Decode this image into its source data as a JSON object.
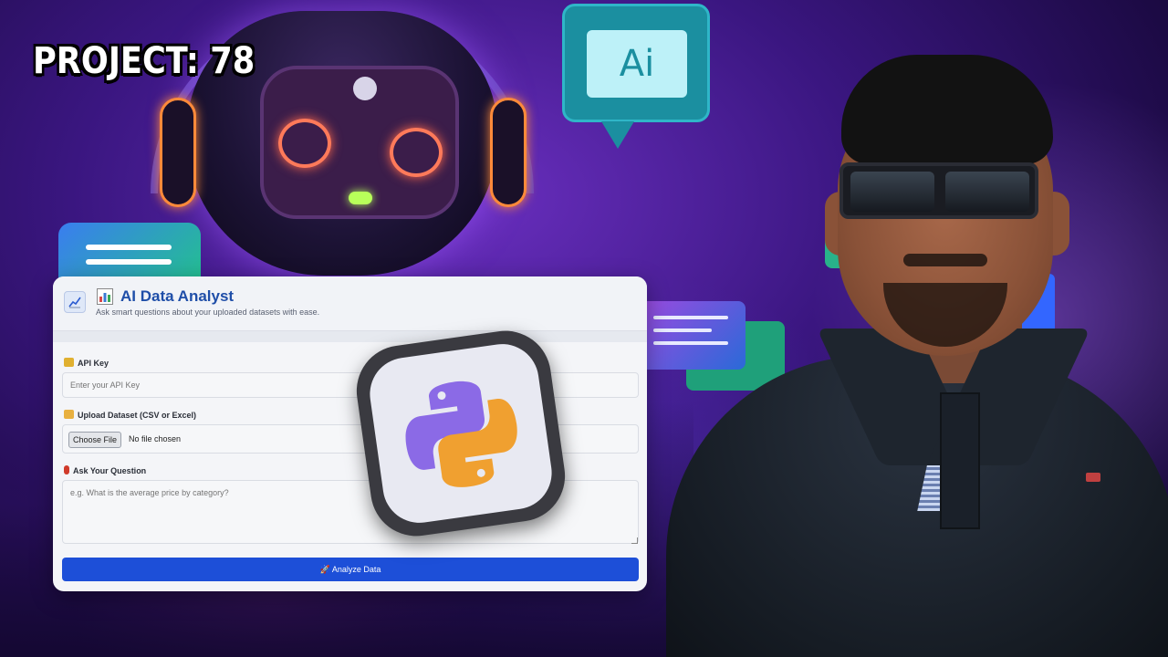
{
  "overlay": {
    "project_title": "PROJECT: 78",
    "ai_bubble_text": "Ai"
  },
  "app": {
    "title": "AI Data Analyst",
    "subtitle": "Ask smart questions about your uploaded datasets with ease.",
    "api_key": {
      "label": "API Key",
      "placeholder": "Enter your API Key",
      "value": ""
    },
    "upload": {
      "label": "Upload Dataset (CSV or Excel)",
      "button_label": "Choose File",
      "status": "No file chosen"
    },
    "question": {
      "label": "Ask Your Question",
      "placeholder": "e.g. What is the average price by category?",
      "value": ""
    },
    "analyze_button": "🚀 Analyze Data"
  },
  "icons": {
    "app_logo": "line-chart-icon",
    "title_icon": "bar-chart-icon",
    "api_key_icon": "key-icon",
    "upload_icon": "folder-icon",
    "question_icon": "question-mark-icon",
    "python_logo": "python-logo"
  },
  "colors": {
    "accent": "#1d4fd8",
    "title": "#1f4ea8",
    "background": "#3a1680"
  }
}
